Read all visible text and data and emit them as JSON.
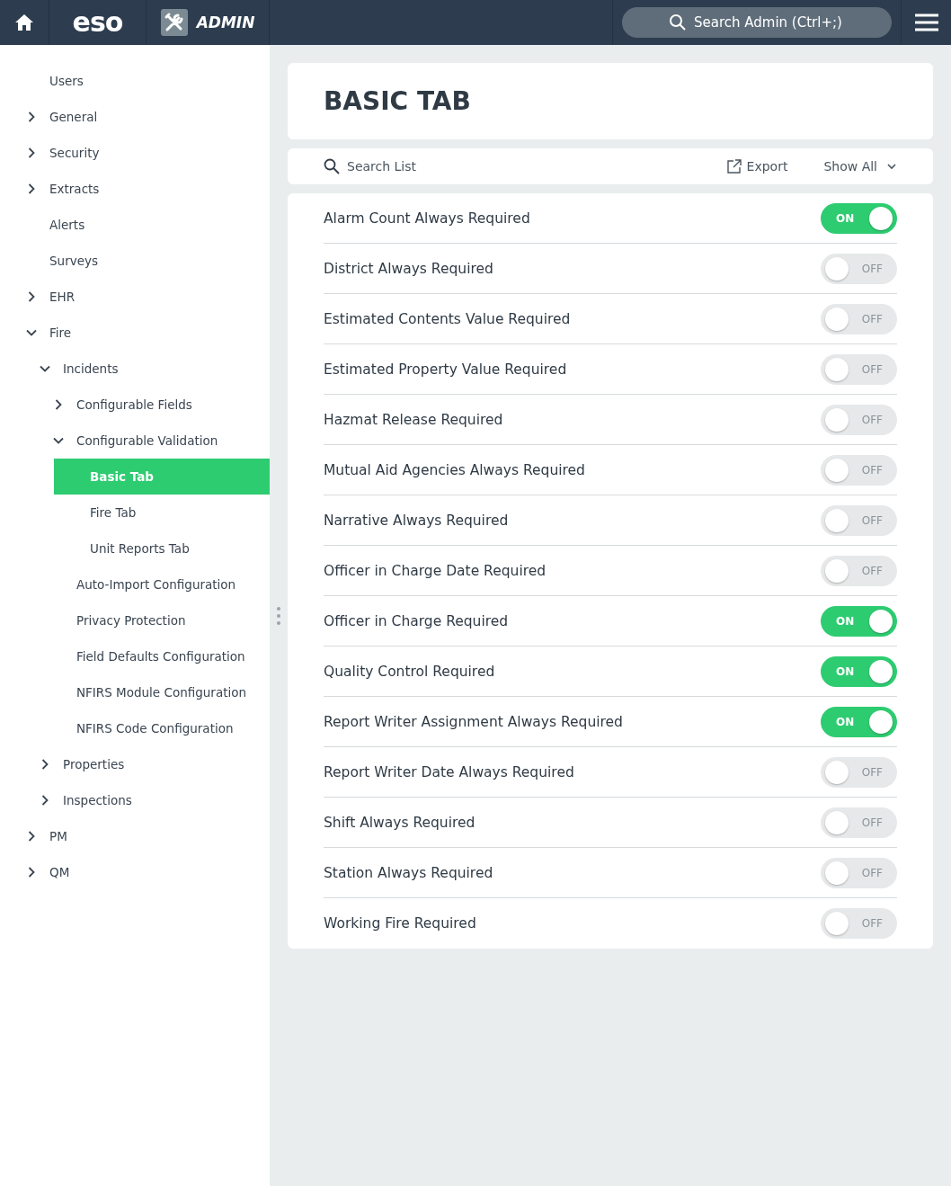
{
  "topbar": {
    "logo": "eso",
    "app_name": "ADMIN",
    "search": {
      "placeholder": "Search Admin (Ctrl+;)"
    }
  },
  "sidebar": {
    "items": [
      {
        "label": "Users",
        "selected": false
      },
      {
        "label": "General",
        "selected": false,
        "expanded": false
      },
      {
        "label": "Security",
        "selected": false,
        "expanded": false
      },
      {
        "label": "Extracts",
        "selected": false,
        "expanded": false
      },
      {
        "label": "Alerts",
        "selected": false
      },
      {
        "label": "Surveys",
        "selected": false
      },
      {
        "label": "EHR",
        "selected": false,
        "expanded": false
      },
      {
        "label": "Fire",
        "selected": false,
        "expanded": true,
        "children": [
          {
            "label": "Incidents",
            "selected": false,
            "expanded": true,
            "children": [
              {
                "label": "Configurable Fields",
                "selected": false,
                "expanded": false
              },
              {
                "label": "Configurable Validation",
                "selected": false,
                "expanded": true,
                "children": [
                  {
                    "label": "Basic Tab",
                    "selected": true
                  },
                  {
                    "label": "Fire Tab",
                    "selected": false
                  },
                  {
                    "label": "Unit Reports Tab",
                    "selected": false
                  }
                ]
              },
              {
                "label": "Auto-Import Configuration",
                "selected": false
              },
              {
                "label": "Privacy Protection",
                "selected": false
              },
              {
                "label": "Field Defaults Configuration",
                "selected": false
              },
              {
                "label": "NFIRS Module Configuration",
                "selected": false
              },
              {
                "label": "NFIRS Code Configuration",
                "selected": false
              }
            ]
          },
          {
            "label": "Properties",
            "selected": false,
            "expanded": false
          },
          {
            "label": "Inspections",
            "selected": false,
            "expanded": false
          }
        ]
      },
      {
        "label": "PM",
        "selected": false,
        "expanded": false
      },
      {
        "label": "QM",
        "selected": false,
        "expanded": false
      }
    ]
  },
  "page": {
    "title": "BASIC TAB"
  },
  "toolbar": {
    "search": {
      "placeholder": "Search List"
    },
    "export": "Export",
    "filter": "Show All"
  },
  "settings": [
    {
      "label": "Alarm Count Always Required",
      "on": true,
      "state_text": "ON"
    },
    {
      "label": "District Always Required",
      "on": false,
      "state_text": "OFF"
    },
    {
      "label": "Estimated Contents Value Required",
      "on": false,
      "state_text": "OFF"
    },
    {
      "label": "Estimated Property Value Required",
      "on": false,
      "state_text": "OFF"
    },
    {
      "label": "Hazmat Release Required",
      "on": false,
      "state_text": "OFF"
    },
    {
      "label": "Mutual Aid Agencies Always Required",
      "on": false,
      "state_text": "OFF"
    },
    {
      "label": "Narrative Always Required",
      "on": false,
      "state_text": "OFF"
    },
    {
      "label": "Officer in Charge Date Required",
      "on": false,
      "state_text": "OFF"
    },
    {
      "label": "Officer in Charge Required",
      "on": true,
      "state_text": "ON"
    },
    {
      "label": "Quality Control Required",
      "on": true,
      "state_text": "ON"
    },
    {
      "label": "Report Writer Assignment Always Required",
      "on": true,
      "state_text": "ON"
    },
    {
      "label": "Report Writer Date Always Required",
      "on": false,
      "state_text": "OFF"
    },
    {
      "label": "Shift Always Required",
      "on": false,
      "state_text": "OFF"
    },
    {
      "label": "Station Always Required",
      "on": false,
      "state_text": "OFF"
    },
    {
      "label": "Working Fire Required",
      "on": false,
      "state_text": "OFF"
    }
  ]
}
